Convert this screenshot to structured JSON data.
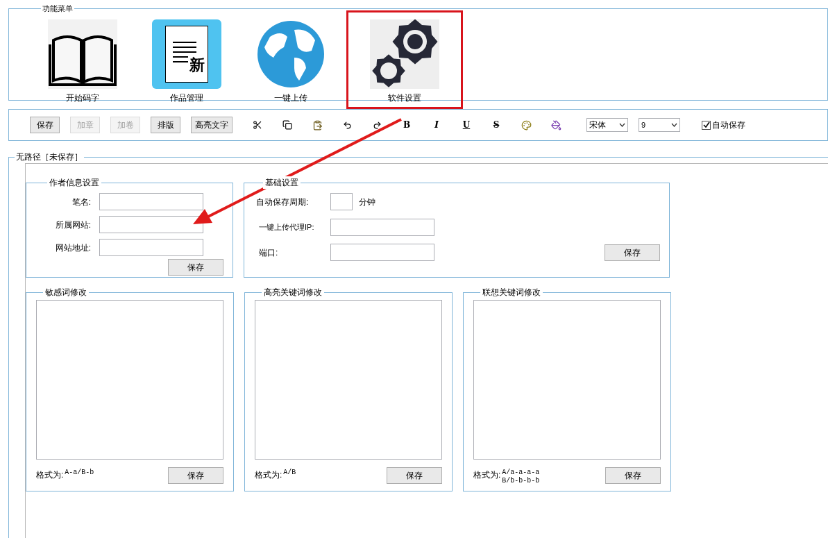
{
  "menu": {
    "title": "功能菜单",
    "items": [
      {
        "kind": "book",
        "label": "开始码字",
        "selected": false
      },
      {
        "kind": "document",
        "label": "作品管理",
        "icon_text": "新",
        "selected": false
      },
      {
        "kind": "globe",
        "label": "一键上传",
        "selected": false
      },
      {
        "kind": "gears",
        "label": "软件设置",
        "selected": true
      }
    ]
  },
  "toolbar": {
    "buttons": [
      {
        "label": "保存",
        "disabled": false
      },
      {
        "label": "加章",
        "disabled": true
      },
      {
        "label": "加卷",
        "disabled": true
      },
      {
        "label": "排版",
        "disabled": false
      },
      {
        "label": "高亮文字",
        "disabled": false
      }
    ],
    "tools": [
      {
        "kind": "cut"
      },
      {
        "kind": "copy"
      },
      {
        "kind": "paste"
      },
      {
        "kind": "undo"
      },
      {
        "kind": "redo"
      },
      {
        "kind": "bold",
        "label": "B"
      },
      {
        "kind": "italic",
        "label": "I"
      },
      {
        "kind": "underline",
        "label": "U"
      },
      {
        "kind": "strike",
        "label": "S"
      },
      {
        "kind": "palette"
      },
      {
        "kind": "fill"
      }
    ],
    "font": "宋体",
    "size": "9",
    "autosave": {
      "label": "自动保存",
      "checked": true
    }
  },
  "document": {
    "title": "无路径［未保存］",
    "author": {
      "title": "作者信息设置",
      "fields": [
        {
          "label": "笔名:"
        },
        {
          "label": "所属网站:"
        },
        {
          "label": "网站地址:"
        }
      ],
      "button": "保存"
    },
    "basic": {
      "title": "基础设置",
      "period_label": "自动保存周期:",
      "period_unit": "分钟",
      "proxy_label": "一键上传代理IP:",
      "port_label": "端口:",
      "button": "保存"
    },
    "lists": [
      {
        "title": "敏感词修改",
        "format_label": "格式为:",
        "format_lines": [
          "A-a/B-b"
        ],
        "button": "保存"
      },
      {
        "title": "高亮关键词修改",
        "format_label": "格式为:",
        "format_lines": [
          "A/B"
        ],
        "button": "保存"
      },
      {
        "title": "联想关键词修改",
        "format_label": "格式为:",
        "format_lines": [
          "A/a-a-a-a",
          "B/b-b-b-b"
        ],
        "button": "保存"
      }
    ]
  },
  "annotation": {
    "arrow": true
  }
}
